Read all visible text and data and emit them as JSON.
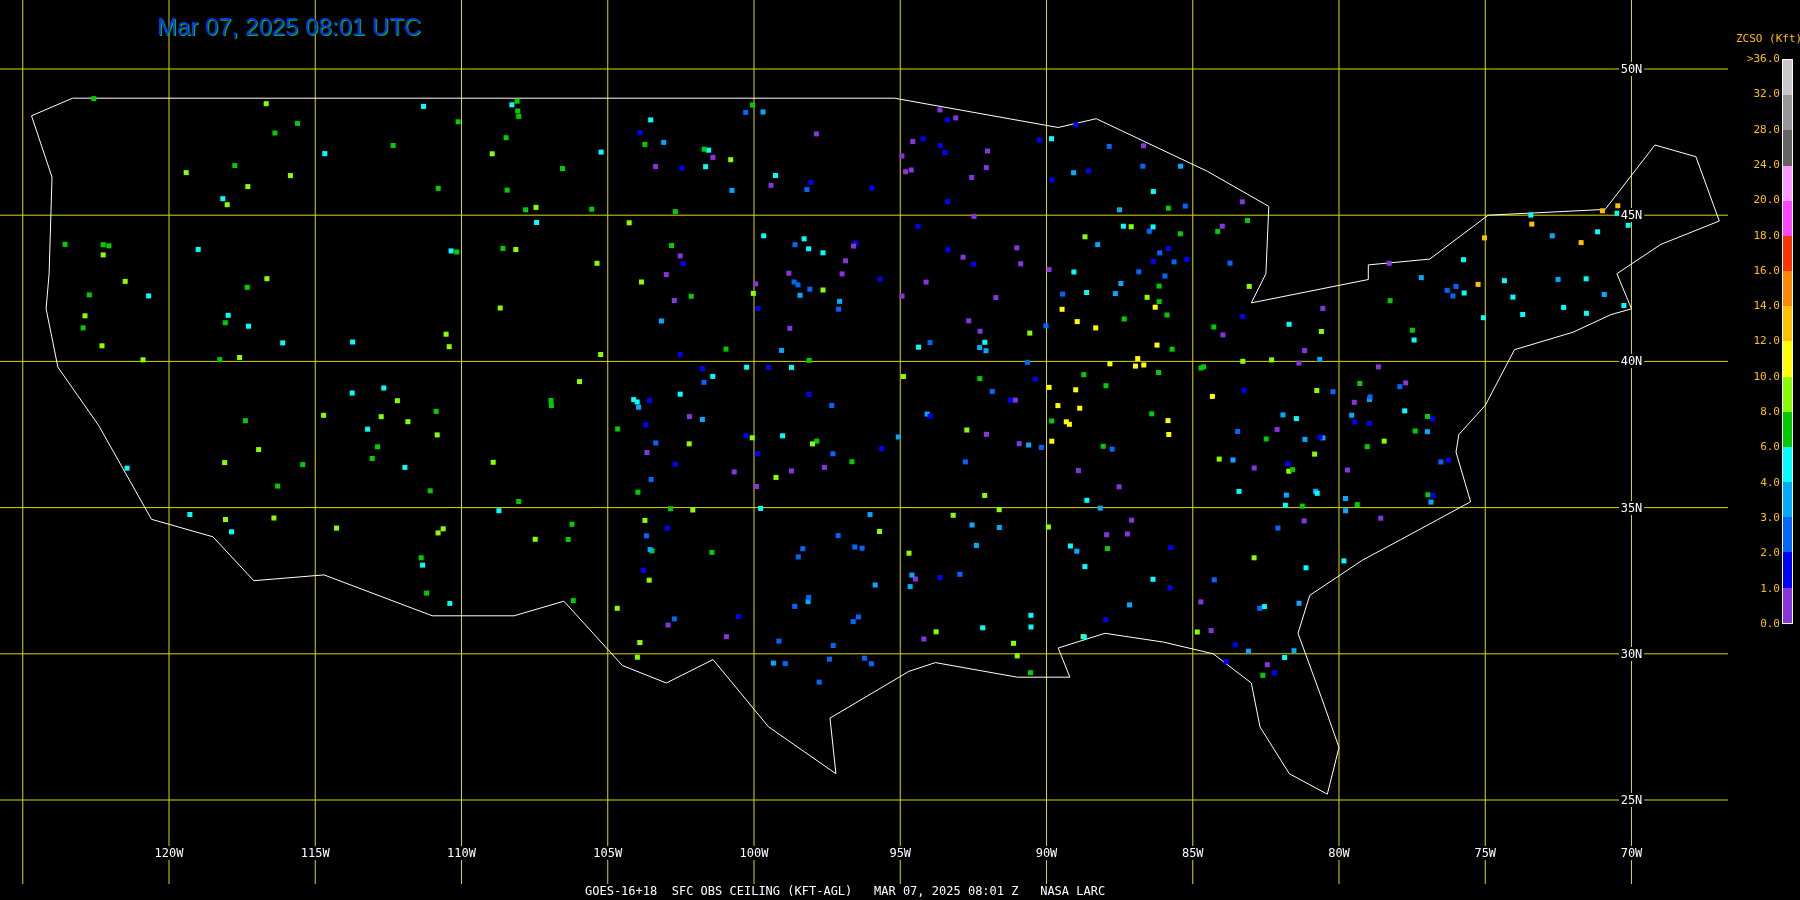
{
  "title": "Mar 07, 2025 08:01 UTC",
  "lat_labels": [
    "50N",
    "45N",
    "40N",
    "35N",
    "30N",
    "25N"
  ],
  "lon_labels": [
    "120W",
    "115W",
    "110W",
    "105W",
    "100W",
    "95W",
    "90W",
    "85W",
    "80W",
    "75W",
    "70W"
  ],
  "legend": {
    "title": "ZCSO (Kft)",
    "labels": [
      ">36.0",
      "32.0",
      "28.0",
      "24.0",
      "20.0",
      "18.0",
      "16.0",
      "14.0",
      "12.0",
      "10.0",
      "8.0",
      "6.0",
      "4.0",
      "3.0",
      "2.0",
      "1.0",
      "0.0"
    ],
    "bands": [
      {
        "color": "#c8c8c8"
      },
      {
        "color": "#969696"
      },
      {
        "color": "#646464"
      },
      {
        "color": "#ff99ff"
      },
      {
        "color": "#ff44ff"
      },
      {
        "color": "#ff3300"
      },
      {
        "color": "#ff8800"
      },
      {
        "color": "#ffc000"
      },
      {
        "color": "#ffff00"
      },
      {
        "color": "#88ff00"
      },
      {
        "color": "#00cc00"
      },
      {
        "color": "#00ffff"
      },
      {
        "color": "#00aaff"
      },
      {
        "color": "#0066ff"
      },
      {
        "color": "#0000ff"
      },
      {
        "color": "#8833dd"
      }
    ]
  },
  "footer": "GOES-16+18  SFC OBS CEILING (KFT-AGL)   MAR 07, 2025 08:01 Z   NASA LARC"
}
